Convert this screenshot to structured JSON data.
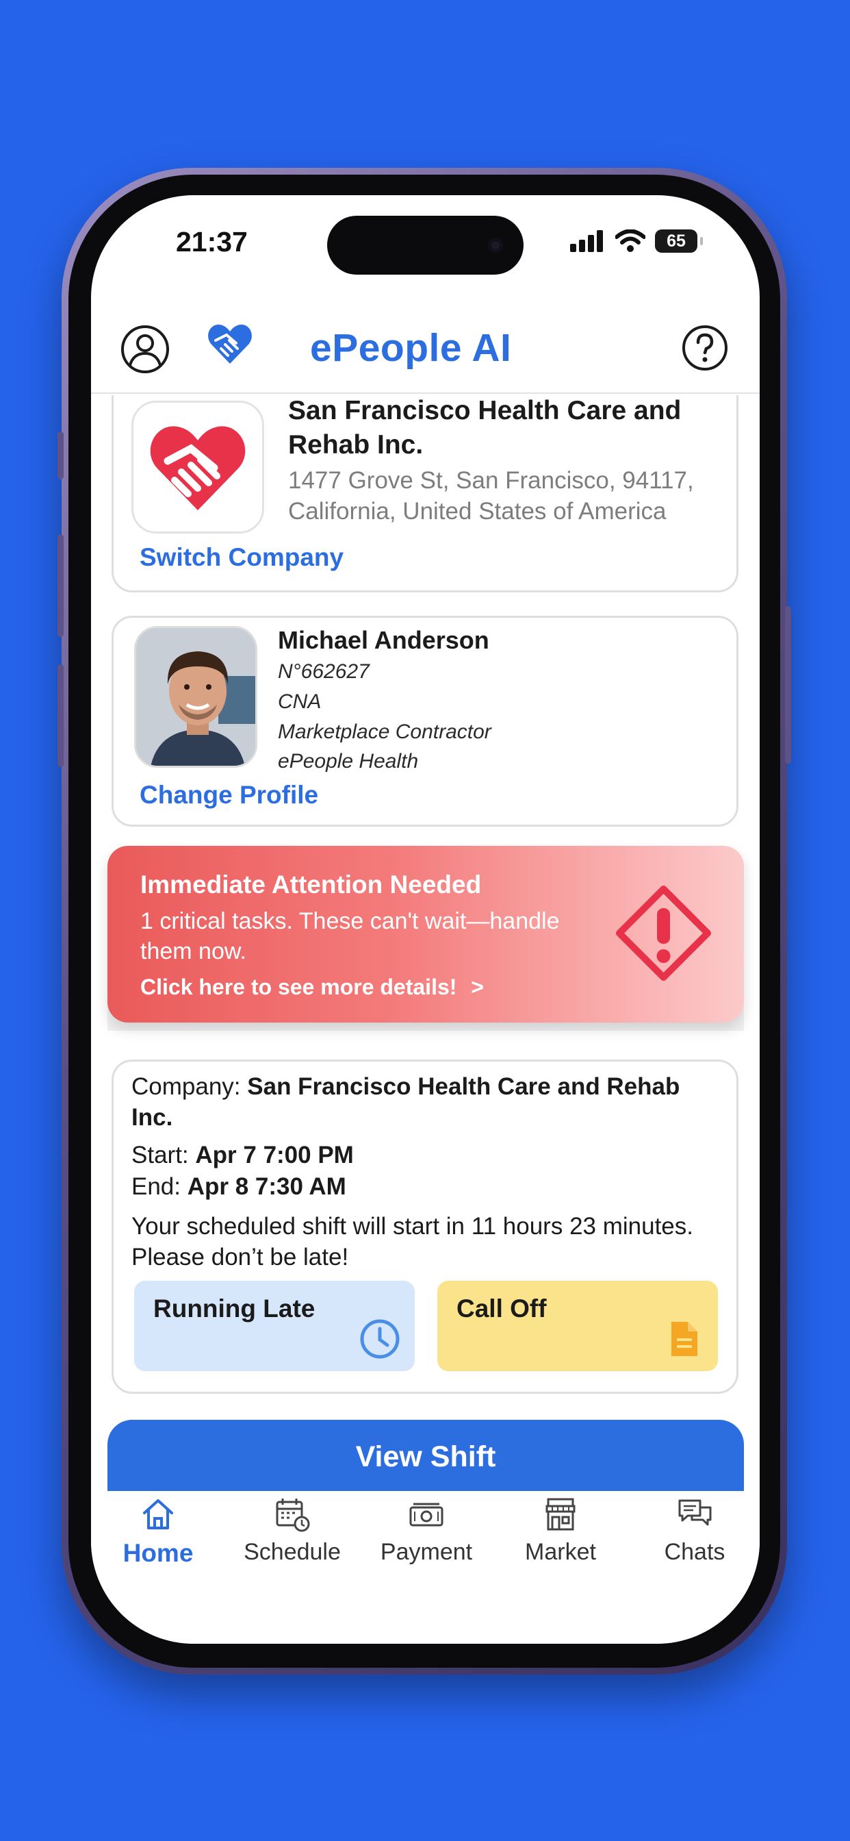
{
  "status_bar": {
    "time": "21:37",
    "battery": "65",
    "icons": [
      "signal-icon",
      "wifi-icon",
      "battery-icon"
    ]
  },
  "header": {
    "title": "ePeople AI",
    "icons": [
      "profile-icon",
      "heart-handshake-logo",
      "help-icon"
    ]
  },
  "company": {
    "name": "San Francisco Health Care and Rehab Inc.",
    "address": "1477 Grove St, San Francisco, 94117, California, United States of America",
    "switch_label": "Switch Company"
  },
  "profile": {
    "name": "Michael Anderson",
    "number": "N°662627",
    "role": "CNA",
    "contract_type": "Marketplace Contractor",
    "organization": "ePeople Health",
    "change_label": "Change Profile"
  },
  "alert": {
    "title": "Immediate Attention Needed",
    "body": "1 critical tasks. These can't wait—handle them now.",
    "link": "Click here to see more details!",
    "link_chevron": ">"
  },
  "shift": {
    "company_label": "Company:",
    "company_value": "San Francisco Health Care and Rehab Inc.",
    "start_label": "Start:",
    "start_value": "Apr 7 7:00 PM",
    "end_label": "End:",
    "end_value": "Apr 8 7:30 AM",
    "message": "Your scheduled shift will start in 11 hours 23 minutes. Please don’t be late!",
    "running_late_label": "Running Late",
    "call_off_label": "Call Off"
  },
  "view_shift_label": "View Shift",
  "nav": {
    "items": [
      {
        "label": "Home",
        "icon": "home-icon",
        "active": true
      },
      {
        "label": "Schedule",
        "icon": "calendar-clock-icon",
        "active": false
      },
      {
        "label": "Payment",
        "icon": "money-icon",
        "active": false
      },
      {
        "label": "Market",
        "icon": "store-icon",
        "active": false
      },
      {
        "label": "Chats",
        "icon": "chat-icon",
        "active": false
      }
    ]
  },
  "colors": {
    "background": "#2563eb",
    "accent": "#2c6de0",
    "alert_red": "#ea5a5a",
    "running_late_bg": "#d6e6fb",
    "call_off_bg": "#fbe38b",
    "call_off_icon": "#f5a623"
  }
}
